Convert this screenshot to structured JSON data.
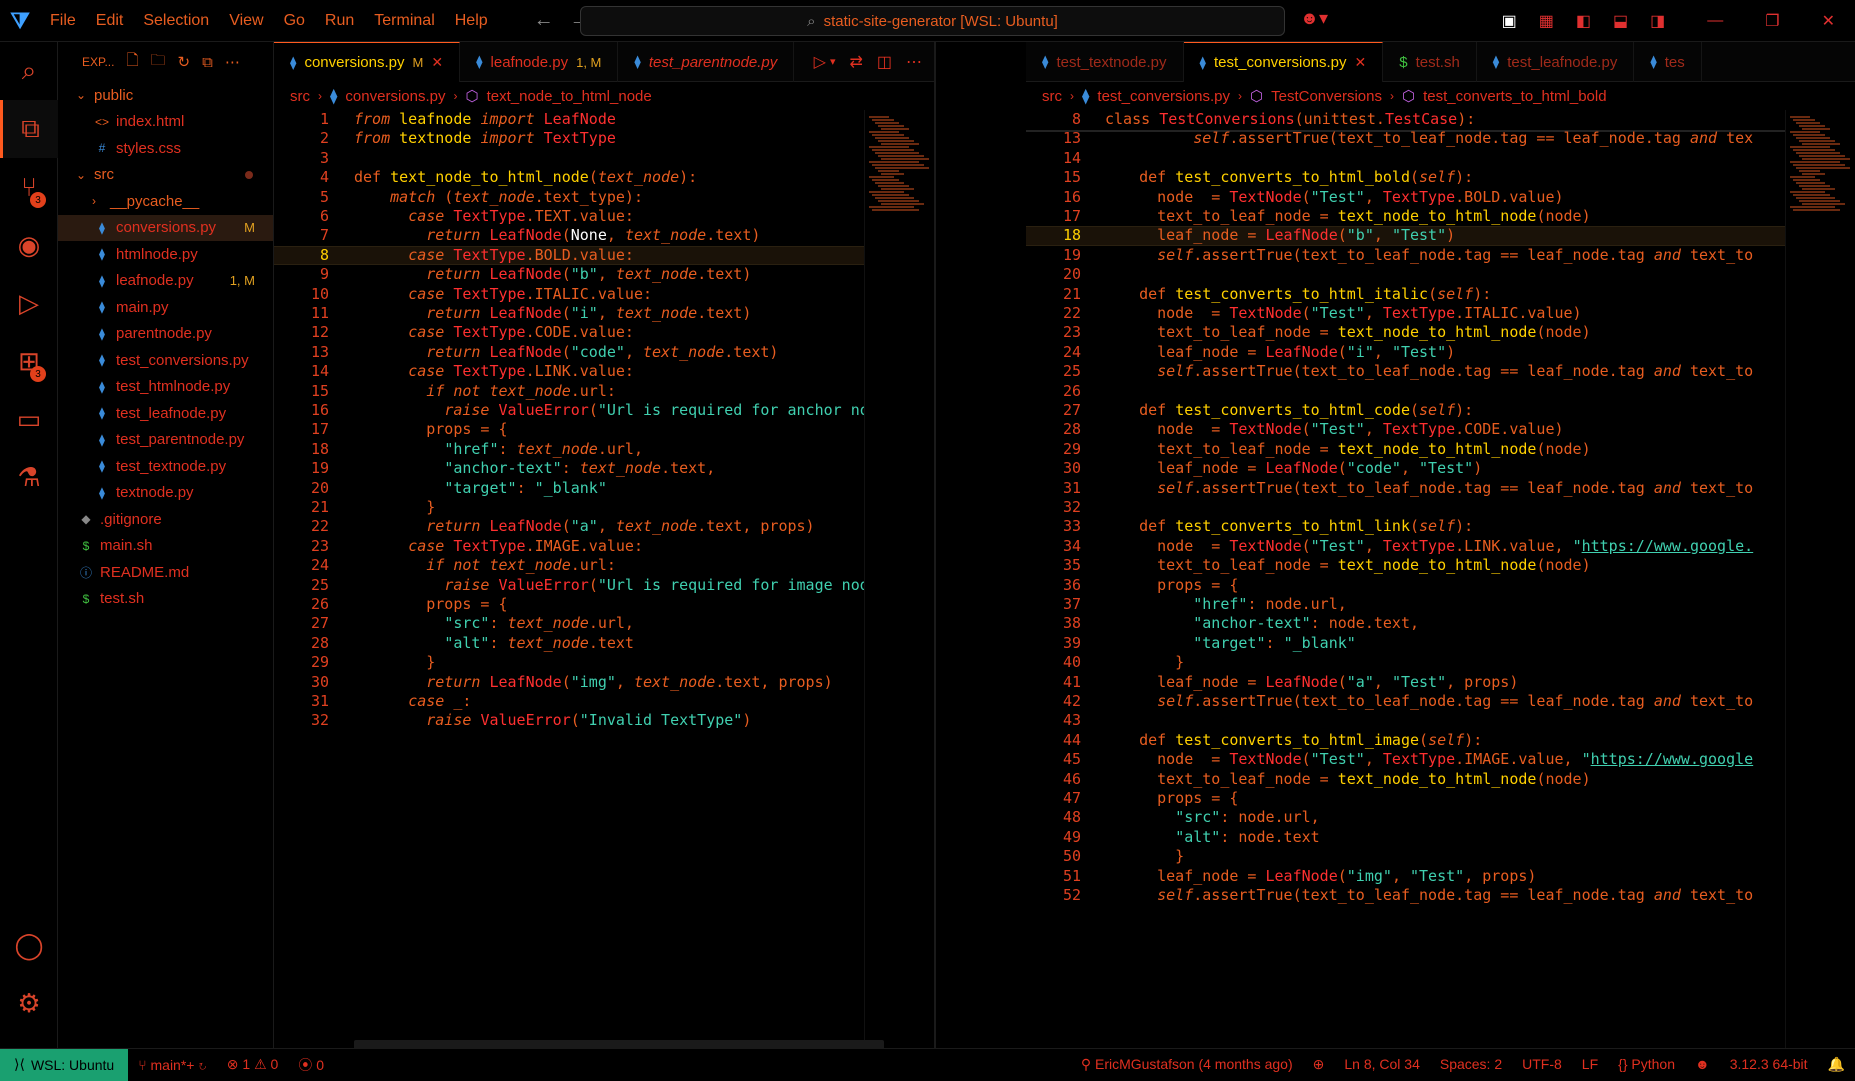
{
  "title": {
    "search": "static-site-generator [WSL: Ubuntu]",
    "menu": [
      "File",
      "Edit",
      "Selection",
      "View",
      "Go",
      "Run",
      "Terminal",
      "Help"
    ]
  },
  "sidebar": {
    "header": "EXP...",
    "items": [
      {
        "name": "public",
        "type": "folder",
        "depth": 0,
        "open": true
      },
      {
        "name": "index.html",
        "type": "html",
        "depth": 1
      },
      {
        "name": "styles.css",
        "type": "css",
        "depth": 1
      },
      {
        "name": "src",
        "type": "folder",
        "depth": 0,
        "open": true,
        "dot": true
      },
      {
        "name": "__pycache__",
        "type": "folder",
        "depth": 1,
        "open": false
      },
      {
        "name": "conversions.py",
        "type": "py",
        "depth": 1,
        "status": "M",
        "selected": true
      },
      {
        "name": "htmlnode.py",
        "type": "py",
        "depth": 1
      },
      {
        "name": "leafnode.py",
        "type": "py",
        "depth": 1,
        "status": "1, M"
      },
      {
        "name": "main.py",
        "type": "py",
        "depth": 1
      },
      {
        "name": "parentnode.py",
        "type": "py",
        "depth": 1
      },
      {
        "name": "test_conversions.py",
        "type": "py",
        "depth": 1
      },
      {
        "name": "test_htmlnode.py",
        "type": "py",
        "depth": 1
      },
      {
        "name": "test_leafnode.py",
        "type": "py",
        "depth": 1
      },
      {
        "name": "test_parentnode.py",
        "type": "py",
        "depth": 1
      },
      {
        "name": "test_textnode.py",
        "type": "py",
        "depth": 1
      },
      {
        "name": "textnode.py",
        "type": "py",
        "depth": 1
      },
      {
        "name": ".gitignore",
        "type": "git",
        "depth": 0
      },
      {
        "name": "main.sh",
        "type": "sh",
        "depth": 0
      },
      {
        "name": "README.md",
        "type": "info",
        "depth": 0
      },
      {
        "name": "test.sh",
        "type": "sh",
        "depth": 0
      }
    ]
  },
  "left_editor": {
    "tabs": [
      {
        "label": "conversions.py",
        "status": "M",
        "active": true
      },
      {
        "label": "leafnode.py",
        "status": "1, M"
      },
      {
        "label": "test_parentnode.py",
        "italic": true
      }
    ],
    "crumbs": [
      "src",
      "conversions.py",
      "text_node_to_html_node"
    ],
    "current_line": 8,
    "lines": [
      "<span class='k'>from</span> <span class='f'>leafnode</span> <span class='k'>import</span> <span class='c'>LeafNode</span>",
      "<span class='k'>from</span> <span class='f'>textnode</span> <span class='k'>import</span> <span class='c'>TextType</span>",
      "",
      "<span class='k' style='font-style:normal'>def</span> <span class='f'>text_node_to_html_node</span>(<span class='v'>text_node</span>):",
      "    <span class='k'>match</span> (<span class='v'>text_node</span>.text_type):",
      "      <span class='k'>case</span> <span class='c'>TextType</span>.TEXT.value:",
      "        <span class='k'>return</span> <span class='c'>LeafNode</span>(<span class='n'>None</span>, <span class='v'>text_node</span>.text)",
      "      <span class='k'>case</span> <span class='c'>TextType</span>.BOLD.value:",
      "        <span class='k'>return</span> <span class='c'>LeafNode</span>(<span class='s'>\"b\"</span>, <span class='v'>text_node</span>.text)",
      "      <span class='k'>case</span> <span class='c'>TextType</span>.ITALIC.value:",
      "        <span class='k'>return</span> <span class='c'>LeafNode</span>(<span class='s'>\"i\"</span>, <span class='v'>text_node</span>.text)",
      "      <span class='k'>case</span> <span class='c'>TextType</span>.CODE.value:",
      "        <span class='k'>return</span> <span class='c'>LeafNode</span>(<span class='s'>\"code\"</span>, <span class='v'>text_node</span>.text)",
      "      <span class='k'>case</span> <span class='c'>TextType</span>.LINK.value:",
      "        <span class='k'>if not</span> <span class='v'>text_node</span>.url:",
      "          <span class='k'>raise</span> <span class='c'>ValueError</span>(<span class='s'>\"Url is required for anchor node</span>",
      "        props = {",
      "          <span class='s'>\"href\"</span>: <span class='v'>text_node</span>.url,",
      "          <span class='s'>\"anchor-text\"</span>: <span class='v'>text_node</span>.text,",
      "          <span class='s'>\"target\"</span>: <span class='s'>\"_blank\"</span>",
      "        }",
      "        <span class='k'>return</span> <span class='c'>LeafNode</span>(<span class='s'>\"a\"</span>, <span class='v'>text_node</span>.text, props)",
      "      <span class='k'>case</span> <span class='c'>TextType</span>.IMAGE.value:",
      "        <span class='k'>if not</span> <span class='v'>text_node</span>.url:",
      "          <span class='k'>raise</span> <span class='c'>ValueError</span>(<span class='s'>\"Url is required for image node\"</span>)",
      "        props = {",
      "          <span class='s'>\"src\"</span>: <span class='v'>text_node</span>.url,",
      "          <span class='s'>\"alt\"</span>: <span class='v'>text_node</span>.text",
      "        }",
      "        <span class='k'>return</span> <span class='c'>LeafNode</span>(<span class='s'>\"img\"</span>, <span class='v'>text_node</span>.text, props)",
      "      <span class='k'>case</span> _:",
      "        <span class='k'>raise</span> <span class='c'>ValueError</span>(<span class='s'>\"Invalid TextType\"</span>)"
    ]
  },
  "right_editor": {
    "tabs": [
      {
        "label": "test_textnode.py"
      },
      {
        "label": "test_conversions.py",
        "active": true
      },
      {
        "label": "test.sh",
        "type": "sh"
      },
      {
        "label": "test_leafnode.py"
      },
      {
        "label": "tes"
      }
    ],
    "crumbs": [
      "src",
      "test_conversions.py",
      "TestConversions",
      "test_converts_to_html_bold"
    ],
    "current_line": 18,
    "sticky": {
      "num": "8",
      "code": "<span class='k' style='font-style:normal'>class</span> <span class='c'>TestConversions</span>(unittest.<span class='c'>TestCase</span>):"
    },
    "start": 13,
    "lines": [
      "        <span class='v'>self</span>.assertTrue(text_to_leaf_node.tag == leaf_node.tag <span class='k'>and</span> tex",
      "",
      "  <span class='k' style='font-style:normal'>def</span> <span class='f'>test_converts_to_html_bold</span>(<span class='v'>self</span>):",
      "    node  = <span class='c'>TextNode</span>(<span class='s'>\"Test\"</span>, <span class='c'>TextType</span>.BOLD.value)",
      "    text_to_leaf_node = <span class='f'>text_node_to_html_node</span>(node)",
      "    leaf_node = <span class='c'>LeafNode</span>(<span class='s'>\"b\"</span>, <span class='s'>\"Test\"</span>)",
      "    <span class='v'>self</span>.assertTrue(text_to_leaf_node.tag == leaf_node.tag <span class='k'>and</span> text_to",
      "",
      "  <span class='k' style='font-style:normal'>def</span> <span class='f'>test_converts_to_html_italic</span>(<span class='v'>self</span>):",
      "    node  = <span class='c'>TextNode</span>(<span class='s'>\"Test\"</span>, <span class='c'>TextType</span>.ITALIC.value)",
      "    text_to_leaf_node = <span class='f'>text_node_to_html_node</span>(node)",
      "    leaf_node = <span class='c'>LeafNode</span>(<span class='s'>\"i\"</span>, <span class='s'>\"Test\"</span>)",
      "    <span class='v'>self</span>.assertTrue(text_to_leaf_node.tag == leaf_node.tag <span class='k'>and</span> text_to",
      "",
      "  <span class='k' style='font-style:normal'>def</span> <span class='f'>test_converts_to_html_code</span>(<span class='v'>self</span>):",
      "    node  = <span class='c'>TextNode</span>(<span class='s'>\"Test\"</span>, <span class='c'>TextType</span>.CODE.value)",
      "    text_to_leaf_node = <span class='f'>text_node_to_html_node</span>(node)",
      "    leaf_node = <span class='c'>LeafNode</span>(<span class='s'>\"code\"</span>, <span class='s'>\"Test\"</span>)",
      "    <span class='v'>self</span>.assertTrue(text_to_leaf_node.tag == leaf_node.tag <span class='k'>and</span> text_to",
      "",
      "  <span class='k' style='font-style:normal'>def</span> <span class='f'>test_converts_to_html_link</span>(<span class='v'>self</span>):",
      "    node  = <span class='c'>TextNode</span>(<span class='s'>\"Test\"</span>, <span class='c'>TextType</span>.LINK.value, <span class='s'>\"<u>https://www.google.</u></span>",
      "    text_to_leaf_node = <span class='f'>text_node_to_html_node</span>(node)",
      "    props = {",
      "        <span class='s'>\"href\"</span>: node.url,",
      "        <span class='s'>\"anchor-text\"</span>: node.text,",
      "        <span class='s'>\"target\"</span>: <span class='s'>\"_blank\"</span>",
      "      }",
      "    leaf_node = <span class='c'>LeafNode</span>(<span class='s'>\"a\"</span>, <span class='s'>\"Test\"</span>, props)",
      "    <span class='v'>self</span>.assertTrue(text_to_leaf_node.tag == leaf_node.tag <span class='k'>and</span> text_to",
      "",
      "  <span class='k' style='font-style:normal'>def</span> <span class='f'>test_converts_to_html_image</span>(<span class='v'>self</span>):",
      "    node  = <span class='c'>TextNode</span>(<span class='s'>\"Test\"</span>, <span class='c'>TextType</span>.IMAGE.value, <span class='s'>\"<u>https://www.google</u></span>",
      "    text_to_leaf_node = <span class='f'>text_node_to_html_node</span>(node)",
      "    props = {",
      "      <span class='s'>\"src\"</span>: node.url,",
      "      <span class='s'>\"alt\"</span>: node.text",
      "      }",
      "    leaf_node = <span class='c'>LeafNode</span>(<span class='s'>\"img\"</span>, <span class='s'>\"Test\"</span>, props)",
      "    <span class='v'>self</span>.assertTrue(text_to_leaf_node.tag == leaf_node.tag <span class='k'>and</span> text_to"
    ]
  },
  "status": {
    "remote": "WSL: Ubuntu",
    "branch": "main*+",
    "errors": "1",
    "warnings": "0",
    "ports": "0",
    "blame": "EricMGustafson (4 months ago)",
    "position": "Ln 8, Col 34",
    "spaces": "Spaces: 2",
    "encoding": "UTF-8",
    "eol": "LF",
    "language": "Python",
    "version": "3.12.3 64-bit"
  }
}
